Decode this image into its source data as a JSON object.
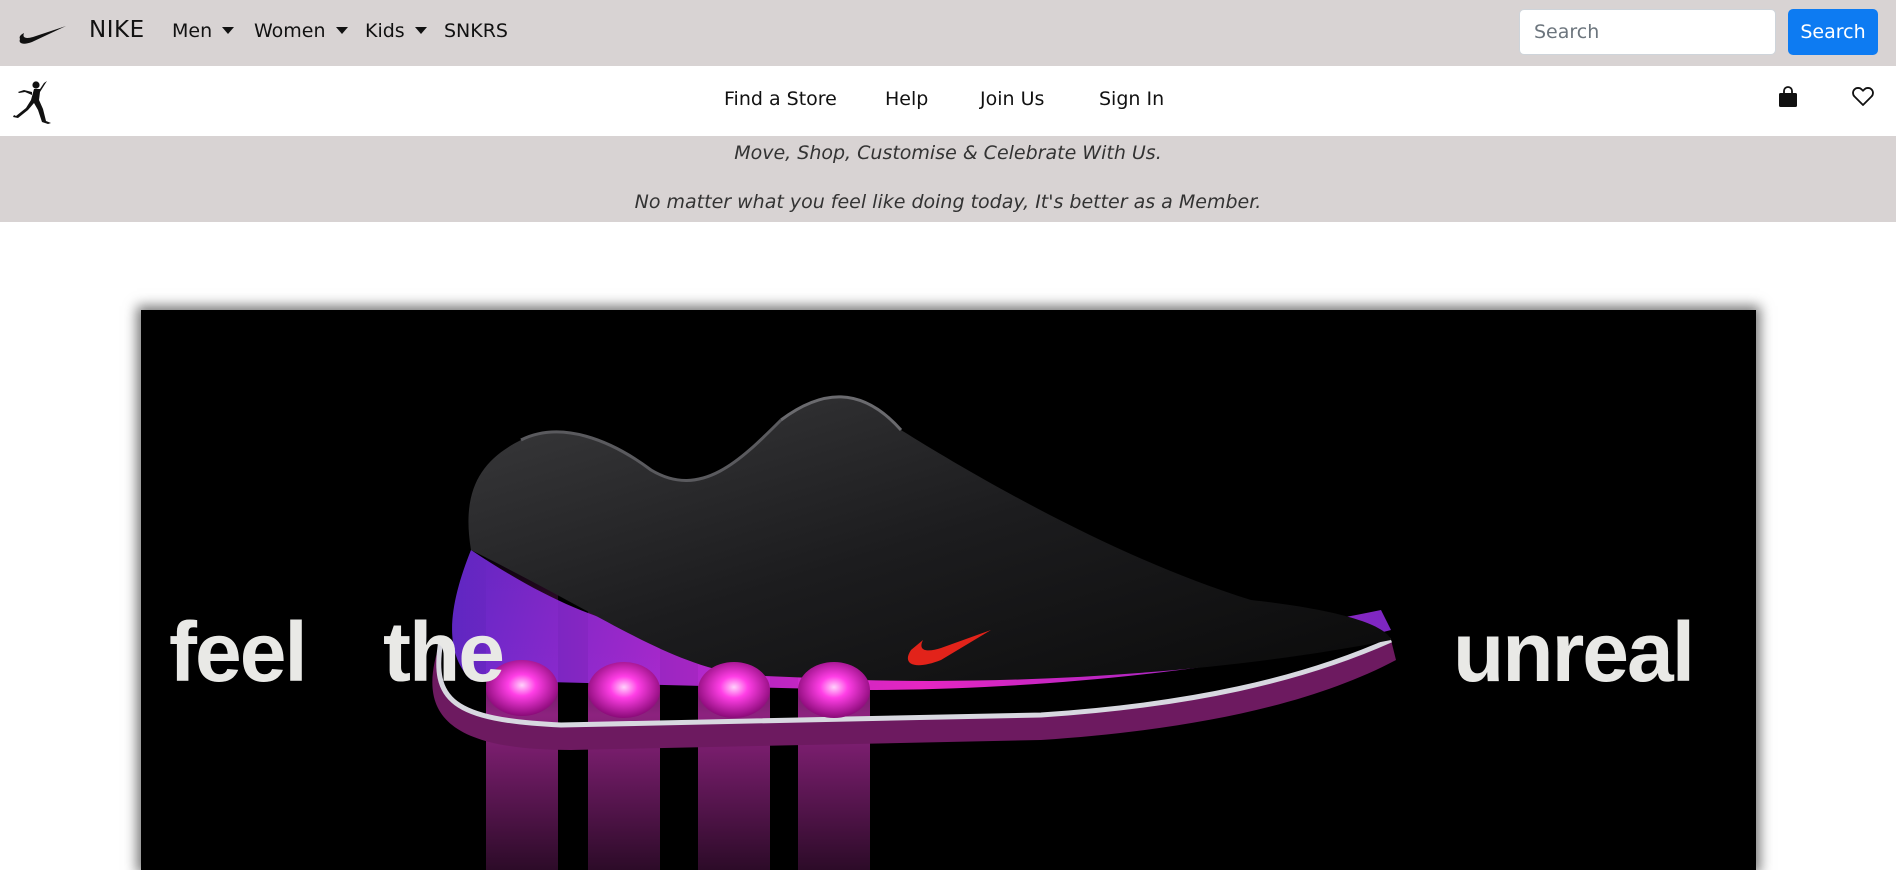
{
  "topnav": {
    "brand": "NIKE",
    "menus": [
      {
        "label": "Men"
      },
      {
        "label": "Women"
      },
      {
        "label": "Kids"
      }
    ],
    "snkrs_label": "SNKRS",
    "search": {
      "placeholder": "Search",
      "value": "",
      "button_label": "Search"
    },
    "logo_icon": "nike-swoosh-icon"
  },
  "subnav": {
    "logo_icon": "jumpman-icon",
    "links": [
      "Find a Store",
      "Help",
      "Join Us",
      "Sign In"
    ],
    "icons": [
      "shopping-bag-icon",
      "heart-icon"
    ]
  },
  "banner": {
    "line1": "Move, Shop, Customise & Celebrate With Us.",
    "line2": "No matter what you feel like doing today, It's better as a Member."
  },
  "hero": {
    "words": [
      "feel",
      "the",
      "unreal"
    ],
    "colors": {
      "background": "#000000",
      "accent": "#ff2ad8"
    }
  },
  "colors": {
    "nav_bg": "#d8d3d3",
    "primary": "#0d7bf2"
  }
}
